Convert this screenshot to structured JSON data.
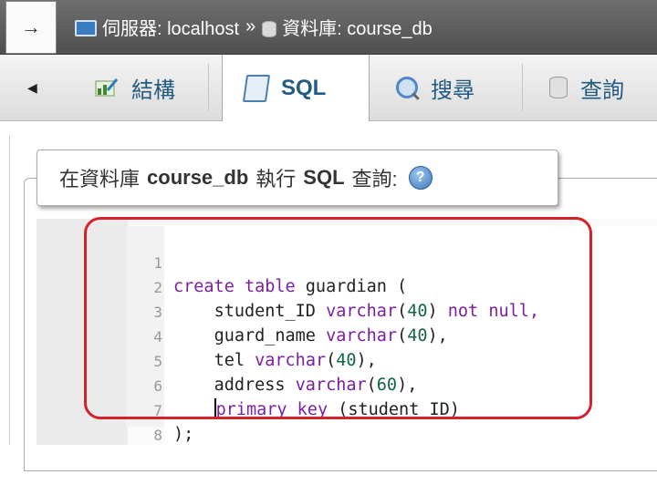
{
  "topbar": {
    "back_label": "→",
    "server_label": "伺服器: localhost",
    "separator": "»",
    "database_label": "資料庫: course_db"
  },
  "tabs": {
    "scroll_left": "◀",
    "items": [
      {
        "label": "結構",
        "icon": "structure-icon",
        "active": false
      },
      {
        "label": "SQL",
        "icon": "sql-icon",
        "active": true
      },
      {
        "label": "搜尋",
        "icon": "search-icon",
        "active": false
      },
      {
        "label": "查詢",
        "icon": "query-icon",
        "active": false
      }
    ]
  },
  "panel": {
    "legend_prefix": "在資料庫",
    "legend_db": "course_db",
    "legend_mid": "執行",
    "legend_sql": "SQL",
    "legend_suffix": "查詢:",
    "help_glyph": "?"
  },
  "editor": {
    "line_numbers": [
      "1",
      "2",
      "3",
      "4",
      "5",
      "6",
      "7",
      "8"
    ],
    "lines": [
      {
        "kw1": "create table",
        "text": " guardian ("
      },
      {
        "indent": "    ",
        "ident": "student_ID ",
        "type": "varchar",
        "num": "40",
        "tail": " not null,"
      },
      {
        "indent": "    ",
        "ident": "guard_name ",
        "type": "varchar",
        "num": "40",
        "tail": ","
      },
      {
        "indent": "    ",
        "ident": "tel ",
        "type": "varchar",
        "num": "40",
        "tail": ","
      },
      {
        "indent": "    ",
        "ident": "address ",
        "type": "varchar",
        "num": "60",
        "tail": ","
      },
      {
        "indent": "    ",
        "kw": "primary key",
        "tail": " (student_ID)"
      },
      {
        "text": ");"
      },
      {
        "text": ""
      }
    ]
  },
  "colors": {
    "accent": "#235a81",
    "highlight": "#d3222a",
    "keyword": "#7a1fa2",
    "number": "#116644"
  }
}
